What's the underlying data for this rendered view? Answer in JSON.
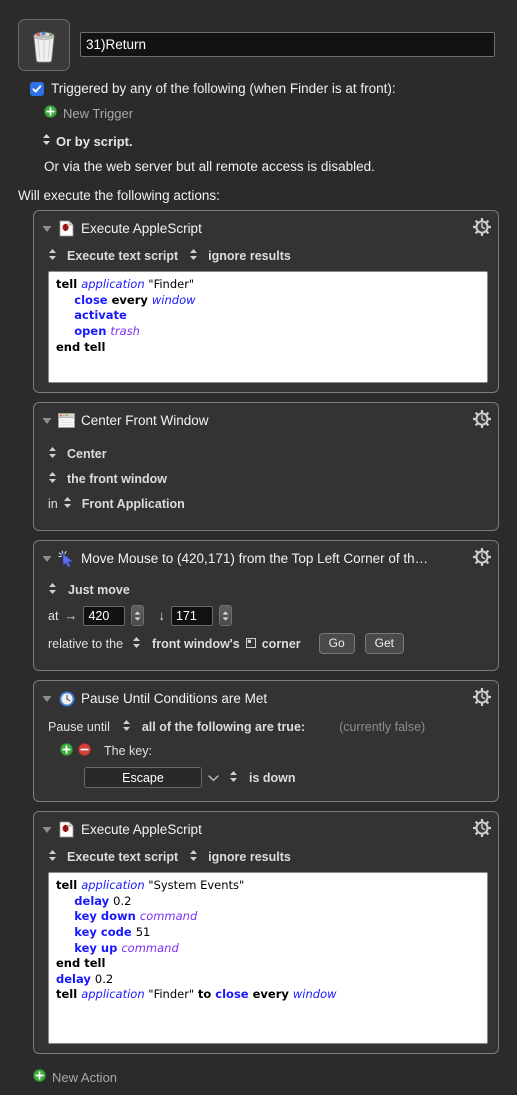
{
  "macro": {
    "icon_name": "trash-can-icon",
    "name_value": "31)Return"
  },
  "triggers": {
    "checkbox_checked": true,
    "label": "Triggered by any of the following (when Finder is at front):",
    "new_trigger_label": "New Trigger",
    "script_label": "Or by script.",
    "web_label": "Or via the web server but all remote access is disabled."
  },
  "actions_header": "Will execute the following actions:",
  "actions": [
    {
      "title": "Execute AppleScript",
      "icon": "applescript-document-icon",
      "opt1": "Execute text script",
      "opt2": "ignore results",
      "script_lines": [
        [
          {
            "t": "tell ",
            "c": "bold"
          },
          {
            "t": "application ",
            "c": "ital"
          },
          {
            "t": "\"Finder\"",
            "c": "plain"
          }
        ],
        [
          {
            "t": "     ",
            "c": "plain"
          },
          {
            "t": "close ",
            "c": "blue"
          },
          {
            "t": "every ",
            "c": "bold"
          },
          {
            "t": "window",
            "c": "ital"
          }
        ],
        [
          {
            "t": "     ",
            "c": "plain"
          },
          {
            "t": "activate",
            "c": "blue"
          }
        ],
        [
          {
            "t": "     ",
            "c": "plain"
          },
          {
            "t": "open ",
            "c": "blue"
          },
          {
            "t": "trash",
            "c": "purple"
          }
        ],
        [
          {
            "t": "end tell",
            "c": "bold"
          }
        ]
      ]
    },
    {
      "title": "Center Front Window",
      "icon": "window-icon",
      "rows": [
        "Center",
        "the front window"
      ],
      "in_label": "in",
      "in_value": "Front Application"
    },
    {
      "title": "Move Mouse to (420,171) from the Top Left Corner of th…",
      "icon": "mouse-cursor-icon",
      "mode": "Just move",
      "at_label": "at",
      "x_value": "420",
      "y_value": "171",
      "rel_label": "relative to the",
      "rel_value": "front window's",
      "corner_label": "corner",
      "go_label": "Go",
      "get_label": "Get"
    },
    {
      "title": "Pause Until Conditions are Met",
      "icon": "clock-icon",
      "pause_label": "Pause until",
      "pause_value": "all of the following are true:",
      "status": "(currently false)",
      "cond_label": "The key:",
      "key_value": "Escape",
      "key_state": "is down"
    },
    {
      "title": "Execute AppleScript",
      "icon": "applescript-document-icon",
      "opt1": "Execute text script",
      "opt2": "ignore results",
      "script_lines": [
        [
          {
            "t": "tell ",
            "c": "bold"
          },
          {
            "t": "application ",
            "c": "ital"
          },
          {
            "t": "\"System Events\"",
            "c": "plain"
          }
        ],
        [
          {
            "t": "     ",
            "c": "plain"
          },
          {
            "t": "delay ",
            "c": "blue"
          },
          {
            "t": "0.2",
            "c": "num"
          }
        ],
        [
          {
            "t": "     ",
            "c": "plain"
          },
          {
            "t": "key down ",
            "c": "blue"
          },
          {
            "t": "command",
            "c": "purple"
          }
        ],
        [
          {
            "t": "     ",
            "c": "plain"
          },
          {
            "t": "key code ",
            "c": "blue"
          },
          {
            "t": "51",
            "c": "num"
          }
        ],
        [
          {
            "t": "     ",
            "c": "plain"
          },
          {
            "t": "key up ",
            "c": "blue"
          },
          {
            "t": "command",
            "c": "purple"
          }
        ],
        [
          {
            "t": "end tell",
            "c": "bold"
          }
        ],
        [
          {
            "t": "delay ",
            "c": "blue"
          },
          {
            "t": "0.2",
            "c": "num"
          }
        ],
        [
          {
            "t": "tell ",
            "c": "bold"
          },
          {
            "t": "application ",
            "c": "ital"
          },
          {
            "t": "\"Finder\" ",
            "c": "plain"
          },
          {
            "t": "to ",
            "c": "bold"
          },
          {
            "t": "close ",
            "c": "blue"
          },
          {
            "t": "every ",
            "c": "bold"
          },
          {
            "t": "window",
            "c": "ital"
          }
        ]
      ]
    }
  ],
  "new_action_label": "New Action",
  "colors": {
    "background": "#2b2b2b",
    "panel": "#333333",
    "accent_blue": "#2b72e8",
    "add_green": "#3fae3f",
    "remove_red": "#d2413c",
    "script_keyword": "#1818ff",
    "script_purple": "#7b2ff7"
  }
}
